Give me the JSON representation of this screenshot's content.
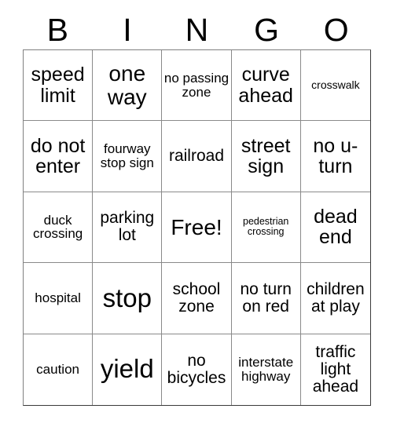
{
  "card": {
    "type": "bingo-card",
    "theme": "road signs",
    "grid_size": "5x5"
  },
  "header": {
    "letters": [
      "B",
      "I",
      "N",
      "G",
      "O"
    ]
  },
  "grid": {
    "rows": [
      [
        {
          "text": "speed limit",
          "size": "l"
        },
        {
          "text": "one way",
          "size": "xl"
        },
        {
          "text": "no passing zone",
          "size": "s"
        },
        {
          "text": "curve ahead",
          "size": "l"
        },
        {
          "text": "crosswalk",
          "size": "xs"
        }
      ],
      [
        {
          "text": "do not enter",
          "size": "l"
        },
        {
          "text": "fourway stop sign",
          "size": "s"
        },
        {
          "text": "railroad",
          "size": "m"
        },
        {
          "text": "street sign",
          "size": "l"
        },
        {
          "text": "no u-turn",
          "size": "l"
        }
      ],
      [
        {
          "text": "duck crossing",
          "size": "s"
        },
        {
          "text": "parking lot",
          "size": "m"
        },
        {
          "text": "Free!",
          "size": "xl",
          "free_space": true
        },
        {
          "text": "pedestrian crossing",
          "size": "xxs"
        },
        {
          "text": "dead end",
          "size": "l"
        }
      ],
      [
        {
          "text": "hospital",
          "size": "s"
        },
        {
          "text": "stop",
          "size": "xxl"
        },
        {
          "text": "school zone",
          "size": "m"
        },
        {
          "text": "no turn on red",
          "size": "m"
        },
        {
          "text": "children at play",
          "size": "m"
        }
      ],
      [
        {
          "text": "caution",
          "size": "s"
        },
        {
          "text": "yield",
          "size": "xxl"
        },
        {
          "text": "no bicycles",
          "size": "m"
        },
        {
          "text": "interstate highway",
          "size": "s"
        },
        {
          "text": "traffic light ahead",
          "size": "m"
        }
      ]
    ]
  }
}
